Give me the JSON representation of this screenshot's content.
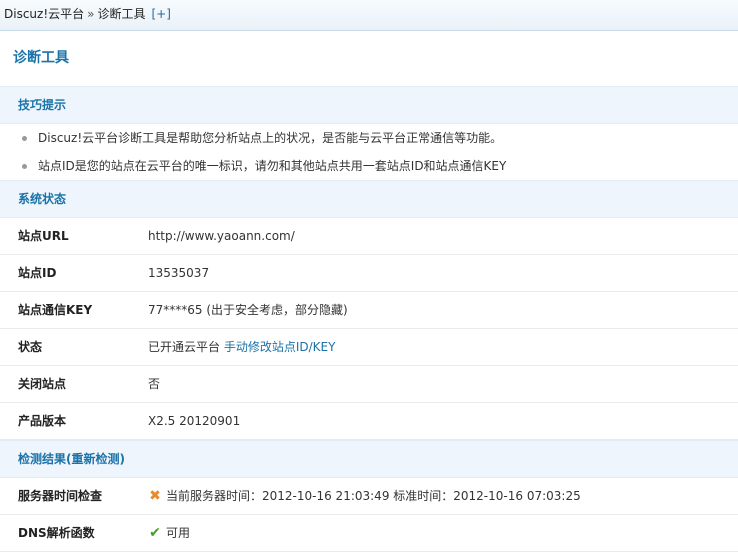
{
  "breadcrumb": {
    "root": "Discuz!云平台",
    "separator": "»",
    "current": "诊断工具",
    "add": "[+]"
  },
  "page_title": "诊断工具",
  "tips": {
    "heading": "技巧提示",
    "items": [
      "Discuz!云平台诊断工具是帮助您分析站点上的状况，是否能与云平台正常通信等功能。",
      "站点ID是您的站点在云平台的唯一标识，请勿和其他站点共用一套站点ID和站点通信KEY"
    ]
  },
  "system_status": {
    "heading": "系统状态",
    "rows": [
      {
        "label": "站点URL",
        "value": "http://www.yaoann.com/"
      },
      {
        "label": "站点ID",
        "value": "13535037"
      },
      {
        "label": "站点通信KEY",
        "value": "77****65 (出于安全考虑，部分隐藏)"
      },
      {
        "label": "状态",
        "value": "已开通云平台",
        "link": "手动修改站点ID/KEY"
      },
      {
        "label": "关闭站点",
        "value": "否"
      },
      {
        "label": "产品版本",
        "value": "X2.5 20120901"
      }
    ]
  },
  "results": {
    "heading_prefix": "检测结果(",
    "heading_link": "重新检测",
    "heading_suffix": ")",
    "rows": [
      {
        "label": "服务器时间检查",
        "icon": "cross-icon",
        "value": "当前服务器时间：2012-10-16 21:03:49 标准时间：2012-10-16 07:03:25"
      },
      {
        "label": "DNS解析函数",
        "icon": "check-icon",
        "value": "可用"
      }
    ]
  },
  "colors": {
    "accent": "#1b73a8",
    "section_bg": "#eef5fc",
    "error": "#e88a2c",
    "ok": "#43a020"
  }
}
